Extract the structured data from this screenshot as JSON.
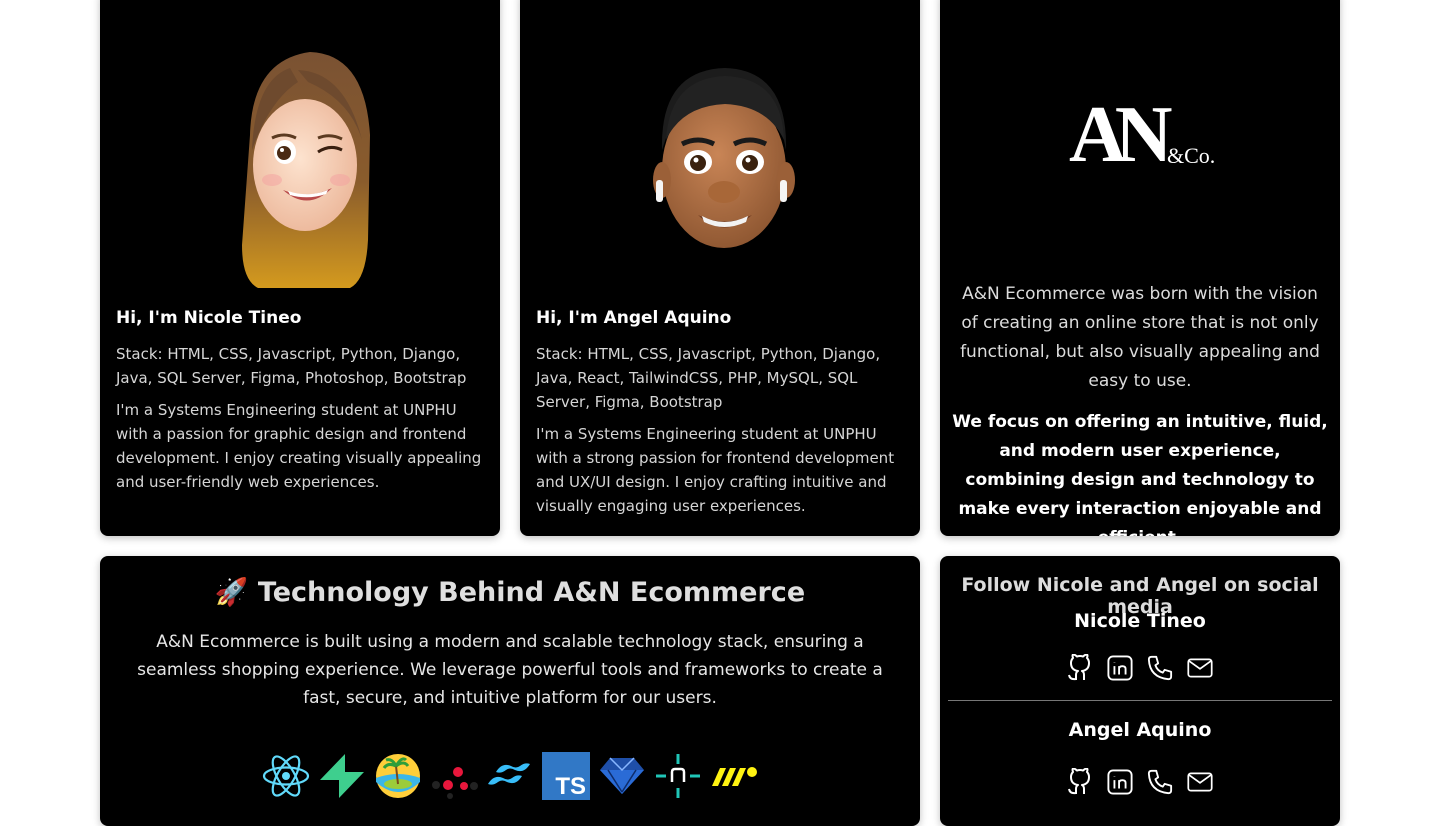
{
  "profiles": [
    {
      "greeting": "Hi, I'm Nicole Tineo",
      "stack": "Stack: HTML, CSS, Javascript, Python, Django, Java, SQL Server, Figma, Photoshop, Bootstrap",
      "bio": "I'm a Systems Engineering student at UNPHU with a passion for graphic design and frontend development. I enjoy creating visually appealing and user-friendly web experiences."
    },
    {
      "greeting": "Hi, I'm Angel Aquino",
      "stack": "Stack: HTML, CSS, Javascript, Python, Django, Java, React, TailwindCSS, PHP, MySQL, SQL Server, Figma, Bootstrap",
      "bio": "I'm a Systems Engineering student at UNPHU with a strong passion for frontend development and UX/UI design. I enjoy crafting intuitive and visually engaging user experiences."
    }
  ],
  "brand": {
    "logo_text": "AN",
    "logo_suffix": "&Co.",
    "paragraph1": "A&N Ecommerce was born with the vision of creating an online store that is not only functional, but also visually appealing and easy to use.",
    "paragraph2": "We focus on offering an intuitive, fluid, and modern user experience, combining design and technology to make every interaction enjoyable and efficient."
  },
  "tech": {
    "emoji": "🚀",
    "title": "Technology Behind A&N Ecommerce",
    "description": "A&N Ecommerce is built using a modern and scalable technology stack, ensuring a seamless shopping experience. We leverage powerful tools and frameworks to create a fast, secure, and intuitive platform for our users.",
    "icons": [
      "react-icon",
      "supabase-icon",
      "island-icon",
      "dots-icon",
      "tailwind-icon",
      "typescript-icon",
      "gem-icon",
      "netlify-icon",
      "motion-icon"
    ],
    "ts_label": "TS"
  },
  "social": {
    "title": "Follow Nicole and Angel on social media",
    "people": [
      {
        "name": "Nicole Tineo",
        "icons": [
          "github-icon",
          "linkedin-icon",
          "phone-icon",
          "mail-icon"
        ]
      },
      {
        "name": "Angel Aquino",
        "icons": [
          "github-icon",
          "linkedin-icon",
          "phone-icon",
          "mail-icon"
        ]
      }
    ]
  },
  "colors": {
    "card_bg": "#000000",
    "page_bg": "#ffffff",
    "react": "#61dafb",
    "supabase": "#3ecf8e",
    "tailwind": "#38bdf8",
    "typescript": "#3178c6",
    "netlify": "#20c6b7",
    "motion": "#fff312"
  }
}
